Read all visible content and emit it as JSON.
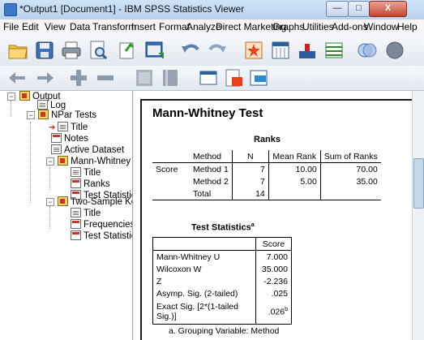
{
  "window": {
    "title": "*Output1 [Document1] - IBM SPSS Statistics Viewer",
    "minimize": "—",
    "maximize": "□",
    "close": "X"
  },
  "menu": [
    "File",
    "Edit",
    "View",
    "Data",
    "Transform",
    "Insert",
    "Format",
    "Analyze",
    "Direct Marketing",
    "Graphs",
    "Utilities",
    "Add-ons",
    "Window",
    "Help"
  ],
  "toolbar1_icons": [
    "open-folder-icon",
    "save-icon",
    "print-icon",
    "print-preview-icon",
    "export-icon",
    "recall-dialog-icon",
    "undo-icon",
    "redo-icon",
    "goto-case-icon",
    "goto-variable-icon",
    "variables-icon",
    "insert-table-icon",
    "use-sets-icon",
    "show-all-icon"
  ],
  "toolbar2_icons": [
    "back-icon",
    "forward-icon",
    "expand-icon",
    "collapse-icon",
    "show-icon",
    "hide-icon",
    "insert-heading-icon",
    "insert-title-icon",
    "insert-text-icon"
  ],
  "outline": {
    "root": "Output",
    "log": "Log",
    "npar": "NPar Tests",
    "title": "Title",
    "notes": "Notes",
    "active_dataset": "Active Dataset",
    "mann_whitney": "Mann-Whitney Test",
    "mw_title": "Title",
    "mw_ranks": "Ranks",
    "mw_stats": "Test Statistics",
    "two_sample": "Two-Sample Kolmogorov-Smirnov Test",
    "ts_title": "Title",
    "ts_freq": "Frequencies",
    "ts_stats": "Test Statistics"
  },
  "content": {
    "heading": "Mann-Whitney Test",
    "ranks": {
      "title": "Ranks",
      "headers": [
        "",
        "Method",
        "N",
        "Mean Rank",
        "Sum of Ranks"
      ],
      "row_label": "Score",
      "rows": [
        {
          "method": "Method 1",
          "n": "7",
          "mean_rank": "10.00",
          "sum_ranks": "70.00"
        },
        {
          "method": "Method 2",
          "n": "7",
          "mean_rank": "5.00",
          "sum_ranks": "35.00"
        },
        {
          "method": "Total",
          "n": "14",
          "mean_rank": "",
          "sum_ranks": ""
        }
      ]
    },
    "test_stats": {
      "title": "Test Statistics",
      "title_sup": "a",
      "col_header": "Score",
      "rows": [
        {
          "label": "Mann-Whitney U",
          "value": "7.000"
        },
        {
          "label": "Wilcoxon W",
          "value": "35.000"
        },
        {
          "label": "Z",
          "value": "-2.236"
        },
        {
          "label": "Asymp. Sig. (2-tailed)",
          "value": ".025"
        }
      ],
      "exact_label_1": "Exact Sig. [2*(1-tailed",
      "exact_label_2": "Sig.)]",
      "exact_value": ".026",
      "exact_sup": "b",
      "footnote": "a. Grouping Variable: Method"
    }
  }
}
